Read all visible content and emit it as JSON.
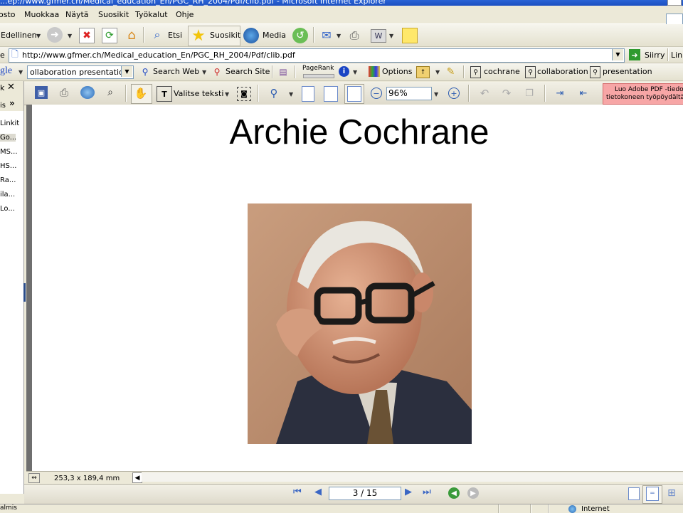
{
  "window": {
    "title": "...ep://www.gfmer.ch/Medical_education_En/PGC_RH_2004/Pdf/clib.pdf - Microsoft Internet Explorer"
  },
  "menu": {
    "items": [
      {
        "label": "osto"
      },
      {
        "label": "Muokkaa"
      },
      {
        "label": "Näytä"
      },
      {
        "label": "Suosikit"
      },
      {
        "label": "Työkalut"
      },
      {
        "label": "Ohje"
      }
    ]
  },
  "nav_toolbar": {
    "back_label": "Edellinen",
    "search_label": "Etsi",
    "favorites_label": "Suosikit",
    "media_label": "Media"
  },
  "address": {
    "prefix": "e",
    "url": "http://www.gfmer.ch/Medical_education_En/PGC_RH_2004/Pdf/clib.pdf",
    "go_label": "Siirry",
    "links_label": "Link"
  },
  "google_toolbar": {
    "logo": "gle",
    "search_value": "ollaboration presentation",
    "search_web_label": "Search Web",
    "search_site_label": "Search Site",
    "pagerank_label": "PageRank",
    "options_label": "Options",
    "highlight_terms": [
      "cochrane",
      "collaboration",
      "presentation"
    ]
  },
  "left_panel": {
    "header_top": "k",
    "header_bottom": "is",
    "items": [
      "Linkit",
      "Go...",
      "MS...",
      "HS...",
      "Ra...",
      "ila...",
      "Lo..."
    ]
  },
  "acrobat_toolbar": {
    "select_text_label": "Valitse teksti",
    "zoom_value": "96%",
    "adobe_pdf_line1": "Luo Adobe PDF -tiedo",
    "adobe_pdf_line2": "tietokoneen työpöydältä"
  },
  "document": {
    "title": "Archie Cochrane",
    "page_size": "253,3 x 189,4 mm",
    "page_indicator": "3 / 15"
  },
  "status_bar": {
    "left_text": "almis",
    "zone_text": "Internet"
  }
}
